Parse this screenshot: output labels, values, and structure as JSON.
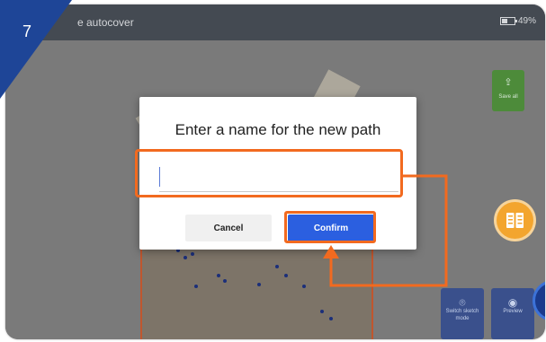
{
  "step_badge": {
    "number": "7",
    "color": "#1e4597"
  },
  "app_bar": {
    "title": "e autocover",
    "battery_label": "49%",
    "battery_level": 0.49
  },
  "side_actions": {
    "save_all_label": "Save all",
    "switch_sketch_label": "Switch sketch mode",
    "preview_label": "Preview",
    "help_icon": "book-icon"
  },
  "dialog": {
    "title": "Enter a name for the new path",
    "input_value": "",
    "cancel_label": "Cancel",
    "confirm_label": "Confirm"
  },
  "colors": {
    "highlight": "#f26a1f",
    "confirm": "#2b5fe0",
    "save_button": "#4d8b3a"
  }
}
